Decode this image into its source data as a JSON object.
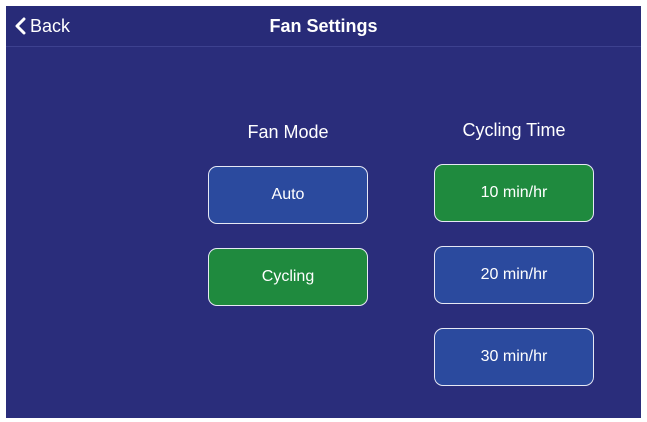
{
  "header": {
    "back_label": "Back",
    "title": "Fan Settings"
  },
  "fan_mode": {
    "label": "Fan Mode",
    "options": [
      {
        "label": "Auto",
        "selected": false
      },
      {
        "label": "Cycling",
        "selected": true
      }
    ]
  },
  "cycling_time": {
    "label": "Cycling Time",
    "options": [
      {
        "label": "10 min/hr",
        "selected": true
      },
      {
        "label": "20 min/hr",
        "selected": false
      },
      {
        "label": "30 min/hr",
        "selected": false
      }
    ]
  },
  "colors": {
    "background": "#2a2d7b",
    "button_off": "#2b4a9e",
    "button_on": "#1f8a3e",
    "button_border": "#e6e8f4"
  },
  "icons": {
    "back": "chevron-left-icon"
  }
}
